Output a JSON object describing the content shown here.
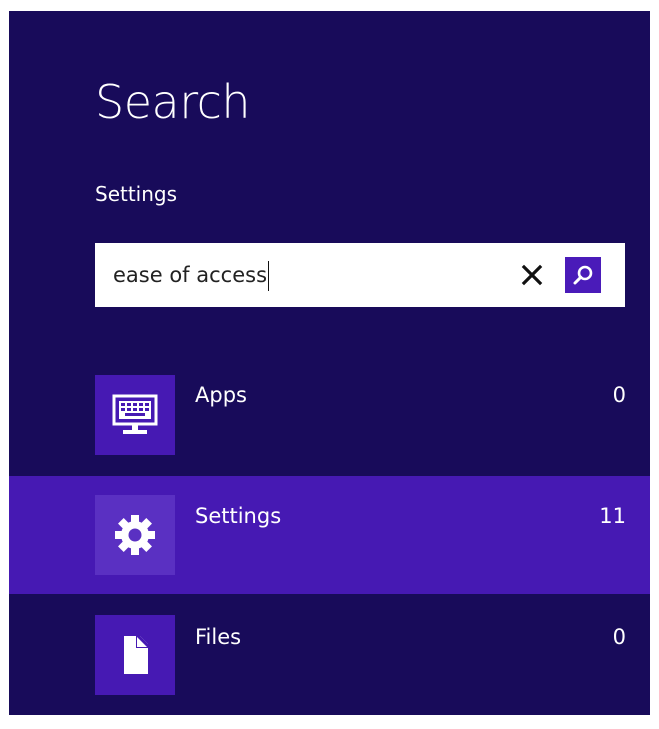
{
  "search_pane": {
    "title": "Search",
    "scope": "Settings",
    "query": "ease of access",
    "icons": {
      "clear": "close-icon",
      "search": "magnifier-icon"
    }
  },
  "results": [
    {
      "label": "Apps",
      "count": "0",
      "icon": "keyboard-monitor-icon",
      "selected": false
    },
    {
      "label": "Settings",
      "count": "11",
      "icon": "gear-icon",
      "selected": true
    },
    {
      "label": "Files",
      "count": "0",
      "icon": "document-icon",
      "selected": false
    }
  ],
  "colors": {
    "background": "#180b5a",
    "accent": "#4619b3",
    "selected_tile": "#5a30c2",
    "search_button": "#4a1bb9",
    "text": "#ffffff"
  }
}
